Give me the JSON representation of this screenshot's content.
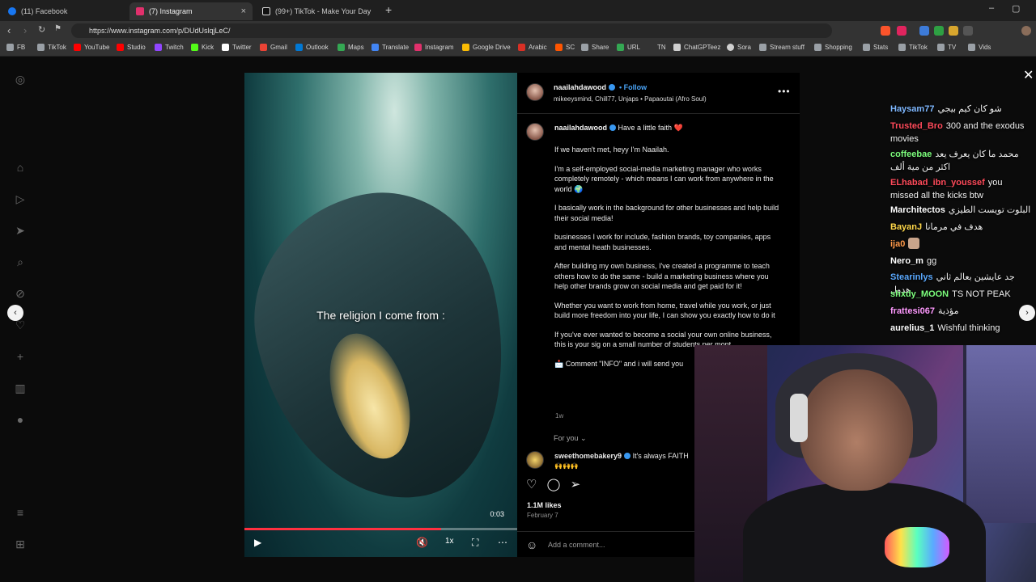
{
  "browser": {
    "tabs": [
      {
        "title": "(11) Facebook",
        "color": "#1877f2"
      },
      {
        "title": "(7) Instagram",
        "color": "#e1306c",
        "close": "×"
      },
      {
        "title": "(99+) TikTok - Make Your Day",
        "color": "#ffffff"
      }
    ],
    "new_tab": "+",
    "url": "https://www.instagram.com/p/DUdUslqjLeC/",
    "bookmarks": [
      {
        "label": "FB",
        "color": "#9aa0a6"
      },
      {
        "label": "TikTok",
        "color": "#9aa0a6"
      },
      {
        "label": "YouTube",
        "color": "#ff0000"
      },
      {
        "label": "Studio",
        "color": "#ff0000"
      },
      {
        "label": "Twitch",
        "color": "#9146ff"
      },
      {
        "label": "Kick",
        "color": "#53fc18"
      },
      {
        "label": "Twitter",
        "color": "#ffffff"
      },
      {
        "label": "Gmail",
        "color": "#ea4335"
      },
      {
        "label": "Outlook",
        "color": "#0078d4"
      },
      {
        "label": "Maps",
        "color": "#34a853"
      },
      {
        "label": "Translate",
        "color": "#4285f4"
      },
      {
        "label": "Instagram",
        "color": "#e1306c"
      },
      {
        "label": "Google Drive",
        "color": "#fbbc04"
      },
      {
        "label": "Arabic",
        "color": "#d93025"
      },
      {
        "label": "SC",
        "color": "#ff5500"
      },
      {
        "label": "Share",
        "color": "#9aa0a6"
      },
      {
        "label": "URL",
        "color": "#34a853"
      },
      {
        "label": "TN",
        "color": "#9aa0a6"
      },
      {
        "label": "ChatGPTeez",
        "color": "#d0d0d0"
      },
      {
        "label": "Sora",
        "color": "#d0d0d0"
      },
      {
        "label": "Stream stuff",
        "color": "#9aa0a6"
      },
      {
        "label": "Shopping",
        "color": "#9aa0a6"
      },
      {
        "label": "Stats",
        "color": "#9aa0a6"
      },
      {
        "label": "TikTok",
        "color": "#9aa0a6"
      },
      {
        "label": "TV",
        "color": "#9aa0a6"
      },
      {
        "label": "Vids",
        "color": "#9aa0a6"
      }
    ]
  },
  "post": {
    "video_caption": "The religion I come from :",
    "time": "0:03",
    "progress": 0.72,
    "speed": "1x",
    "author": "naailahdawood",
    "follow": "Follow",
    "audio": "mikeeysmind, Chill77, Unjaps • Papaoutai (Afro Soul)",
    "caption_title": "Have a little faith ❤️",
    "caption_paragraphs": [
      "If we haven't met, heyy I'm Naailah.",
      "I'm a self-employed social-media marketing manager who works completely remotely - which means I can work from anywhere in the world 🌍",
      "I basically work in the background for other businesses and help build their social media!",
      "businesses I work for include, fashion brands, toy companies, apps and mental heath businesses.",
      "After building my own business, I've created a programme to teach others how to do the same - build a marketing business where you help other brands grow on social media and get paid for it!",
      "Whether you want to work from home, travel while you work, or just build more freedom into your life, I can show you exactly how to do it",
      "If you've ever wanted to become a social your own online business, this is your sig on a small number of students per mont",
      "📩 Comment \"INFO\" and i will send you"
    ],
    "ago": "1w",
    "for_you": "For you ⌄",
    "reply_user": "sweethomebakery9",
    "reply_text": "It's always FAITH",
    "reply_emoji": "🙌🙌🙌",
    "likes": "1.1M likes",
    "date": "February 7",
    "comment_placeholder": "Add a comment..."
  },
  "chat": [
    {
      "user": "Haysam77",
      "color": "#7fb8ff",
      "text": "شو كان كيم بيجي"
    },
    {
      "user": "Trusted_Bro",
      "color": "#ff4a5a",
      "text": "300 and the exodus movies"
    },
    {
      "user": "coffeebae",
      "color": "#7dff7d",
      "text": "محمد ما كان يعرف يعد اكثر من مية ألف"
    },
    {
      "user": "ELhabad_ibn_youssef",
      "color": "#ff4a5a",
      "text": "you missed all the kicks btw"
    },
    {
      "user": "Marchitectos",
      "color": "#ffffff",
      "text": "البلوت تويست الطيزي"
    },
    {
      "user": "BayanJ",
      "color": "#ffd84a",
      "text": "هدف في مرمانا"
    },
    {
      "user": "ija0",
      "color": "#ff9a4a",
      "text": ""
    },
    {
      "user": "Nero_m",
      "color": "#ffffff",
      "text": "gg"
    },
    {
      "user": "Stearinlys",
      "color": "#5aa9ff",
      "text": "جد عايشين بعالم ثاني هدول"
    },
    {
      "user": "shxdy_MOON",
      "color": "#7dff7d",
      "text": "TS NOT PEAK"
    },
    {
      "user": "frattesi067",
      "color": "#ff9aff",
      "text": "مؤذية"
    },
    {
      "user": "aurelius_1",
      "color": "#ffffff",
      "text": "Wishful thinking"
    }
  ]
}
